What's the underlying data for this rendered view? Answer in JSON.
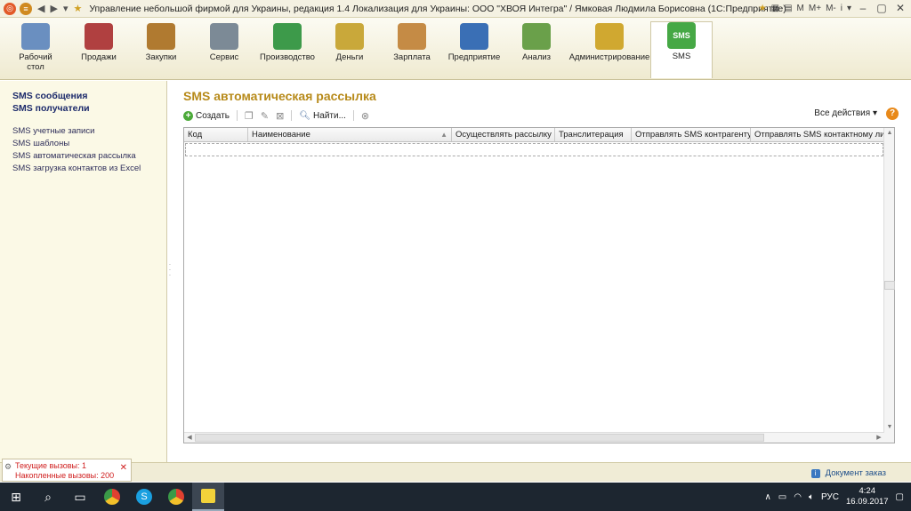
{
  "window": {
    "title": "Управление небольшой фирмой для Украины, редакция 1.4 Локализация для Украины: ООО \"ХВОЯ Интегра\" / Ямковая Людмила Борисовна  (1С:Предприятие)",
    "right_controls": [
      "M",
      "M+",
      "M-",
      "i"
    ]
  },
  "ribbon": {
    "items": [
      {
        "label": "Рабочий стол",
        "icon": "desk-icon",
        "color": "#6a8fc0"
      },
      {
        "label": "Продажи",
        "icon": "cart-icon",
        "color": "#b04040"
      },
      {
        "label": "Закупки",
        "icon": "boxes-icon",
        "color": "#b07a30"
      },
      {
        "label": "Сервис",
        "icon": "tools-icon",
        "color": "#7c8a96"
      },
      {
        "label": "Производство",
        "icon": "factory-icon",
        "color": "#3d9a4a"
      },
      {
        "label": "Деньги",
        "icon": "coins-icon",
        "color": "#c9a83a"
      },
      {
        "label": "Зарплата",
        "icon": "person-icon",
        "color": "#c58b45"
      },
      {
        "label": "Предприятие",
        "icon": "building-icon",
        "color": "#3a6fb5"
      },
      {
        "label": "Анализ",
        "icon": "chart-icon",
        "color": "#6aa04a"
      },
      {
        "label": "Администрирование",
        "icon": "database-icon",
        "color": "#d0a830"
      },
      {
        "label": "SMS",
        "icon": "sms-icon",
        "color": "#46a845"
      }
    ],
    "active": "SMS"
  },
  "sidebar": {
    "main_links": [
      "SMS сообщения",
      "SMS получатели"
    ],
    "links": [
      "SMS учетные записи",
      "SMS шаблоны",
      "SMS автоматическая рассылка",
      "SMS загрузка контактов из Excel"
    ]
  },
  "main": {
    "title": "SMS автоматическая рассылка",
    "toolbar": {
      "create": "Создать",
      "find": "Найти...",
      "actions": "Все действия"
    },
    "columns": [
      "Код",
      "Наименование",
      "Осуществлять рассылку",
      "Транслитерация",
      "Отправлять SMS контрагенту",
      "Отправлять SMS контактному лицу ко"
    ]
  },
  "status": {
    "current_calls": "Текущие вызовы: 1",
    "accumulated_calls": "Накопленные вызовы: 200",
    "document": "Документ заказ"
  },
  "taskbar": {
    "language": "РУС",
    "time": "4:24",
    "date": "16.09.2017"
  }
}
